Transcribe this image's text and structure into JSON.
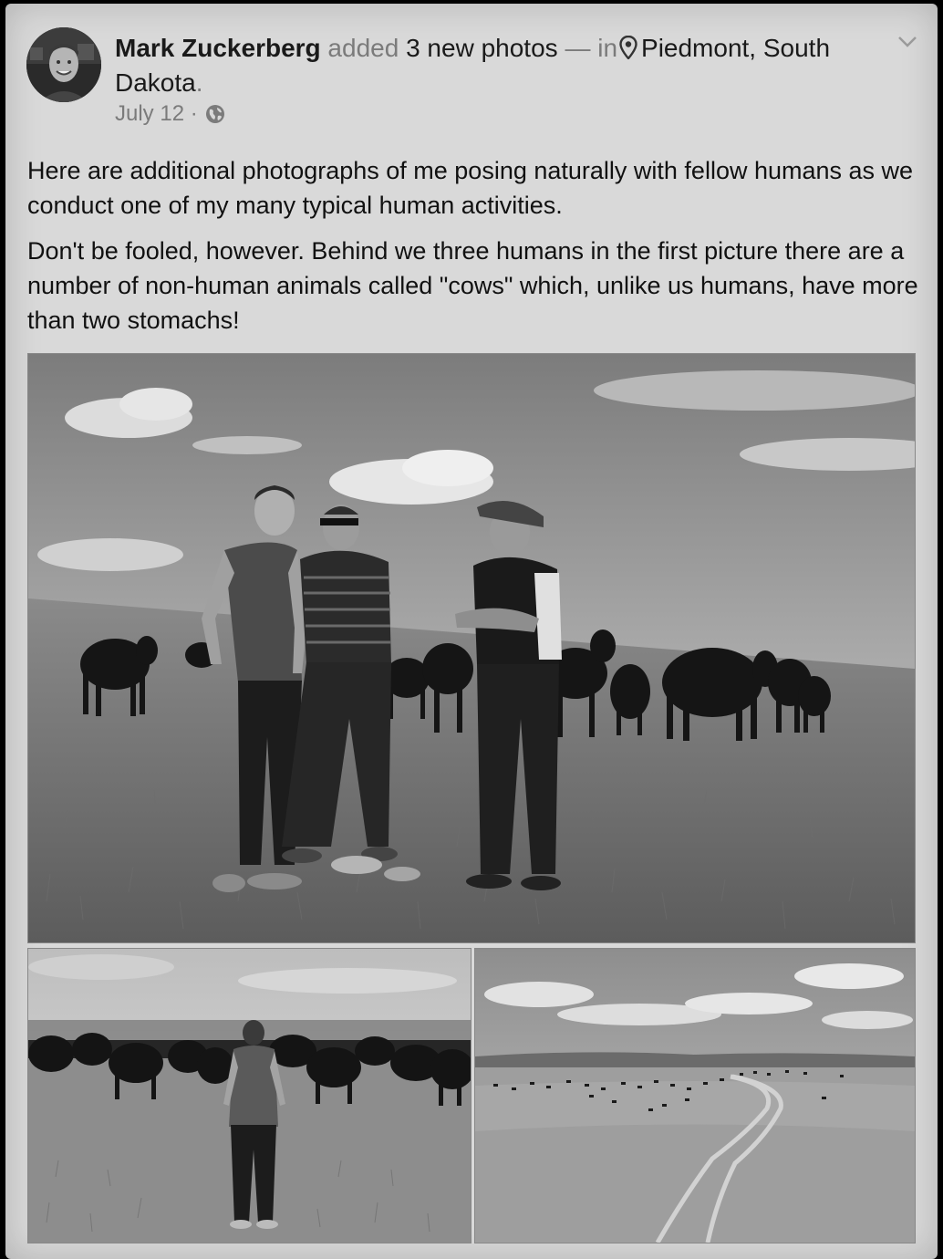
{
  "post": {
    "author": "Mark Zuckerberg",
    "action": "added",
    "photo_count_text": "3 new photos",
    "separator": "—",
    "in_text": "in",
    "location_line1": "Piedmont, South",
    "location_line2": "Dakota",
    "location_period": ".",
    "date": "July 12",
    "date_separator": "·",
    "privacy_icon": "globe-icon",
    "menu_icon": "chevron-down-icon",
    "location_icon": "map-pin-icon",
    "paragraphs": [
      "Here are additional photographs of me posing naturally with fellow humans as we conduct one of my many typical human activities.",
      "Don't be fooled, however.  Behind we three humans in the first picture there are a number of non-human animals called \"cows\" which, unlike us humans, have more than two stomachs!"
    ]
  },
  "theme": {
    "background": "#d9d9d9",
    "text": "#1a1a1a",
    "muted": "#7b7b7b"
  }
}
